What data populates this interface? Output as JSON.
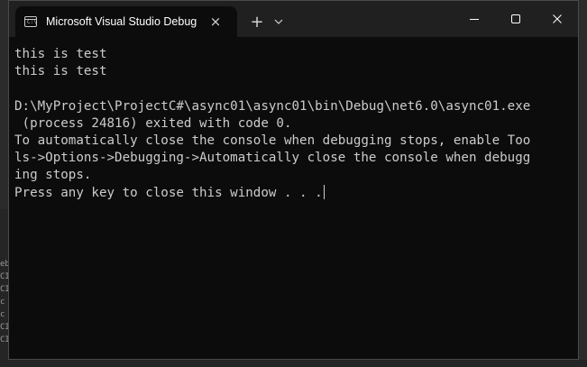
{
  "window": {
    "tab_title": "Microsoft Visual Studio Debug Console",
    "icon_text": "C:\\",
    "close_tab_glyph": "×",
    "new_tab_glyph": "+"
  },
  "console": {
    "lines": [
      "this is test",
      "this is test",
      "",
      "D:\\MyProject\\ProjectC#\\async01\\async01\\bin\\Debug\\net6.0\\async01.exe",
      " (process 24816) exited with code 0.",
      "To automatically close the console when debugging stops, enable Too",
      "ls->Options->Debugging->Automatically close the console when debugg",
      "ing stops.",
      "Press any key to close this window . . ."
    ]
  },
  "background_fragments": [
    "eb",
    "CI",
    "CI",
    "c",
    "c",
    "CI",
    "CI"
  ],
  "colors": {
    "console_bg": "#0c0c0c",
    "console_text": "#cccccc",
    "titlebar_bg": "#202020"
  }
}
